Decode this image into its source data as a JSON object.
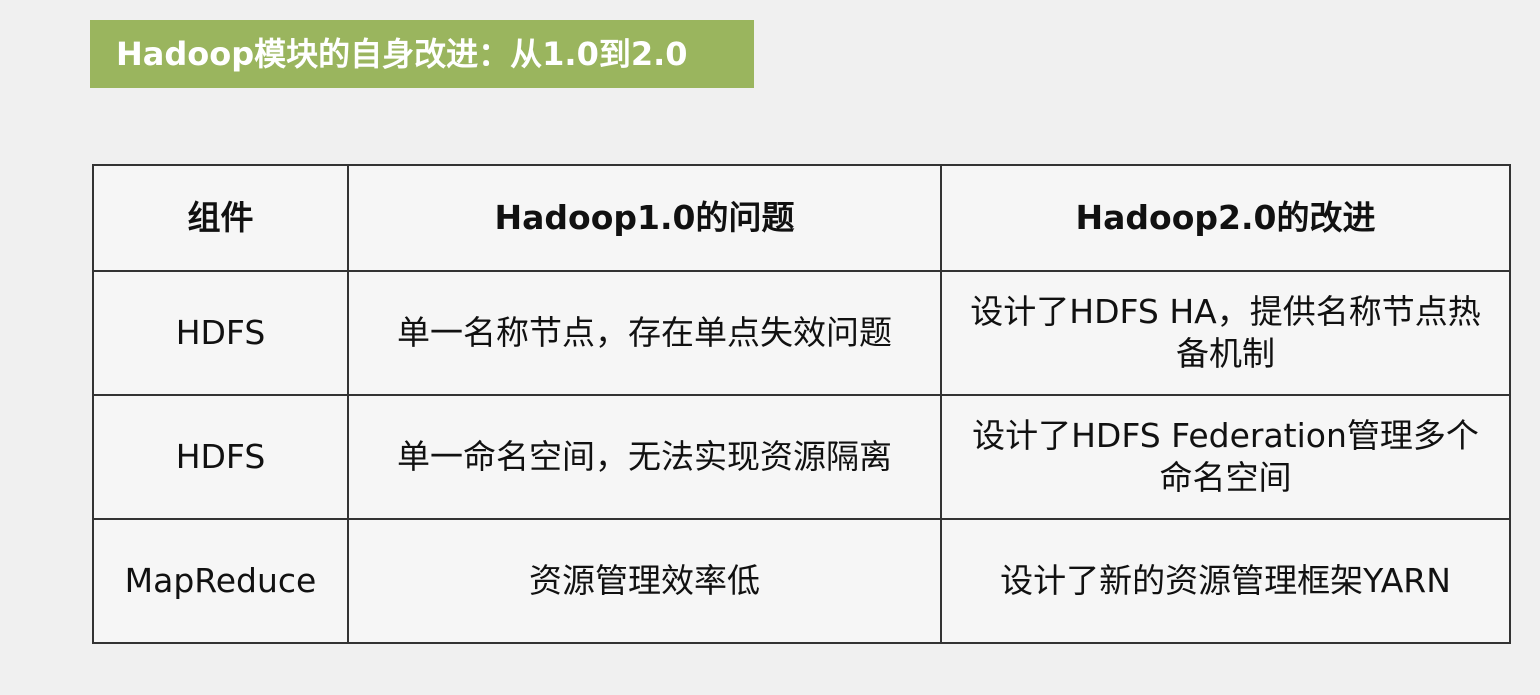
{
  "title": "Hadoop模块的自身改进：从1.0到2.0",
  "table": {
    "headers": [
      "组件",
      "Hadoop1.0的问题",
      "Hadoop2.0的改进"
    ],
    "rows": [
      {
        "component": "HDFS",
        "problem": "单一名称节点，存在单点失效问题",
        "improvement": "设计了HDFS HA，提供名称节点热备机制"
      },
      {
        "component": "HDFS",
        "problem": "单一命名空间，无法实现资源隔离",
        "improvement": "设计了HDFS Federation管理多个命名空间"
      },
      {
        "component": "MapReduce",
        "problem": "资源管理效率低",
        "improvement": "设计了新的资源管理框架YARN"
      }
    ]
  },
  "colors": {
    "banner": "#9ab55e",
    "background": "#f0f0f0",
    "border": "#333333"
  }
}
